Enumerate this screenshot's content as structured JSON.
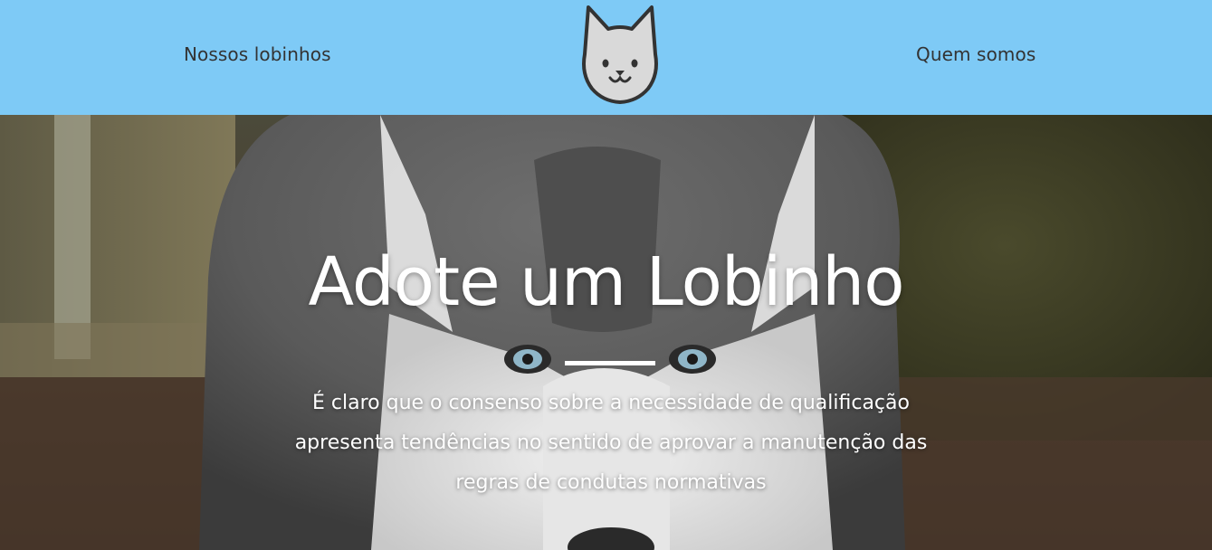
{
  "nav": {
    "left_link": "Nossos lobinhos",
    "right_link": "Quem somos",
    "logo_icon": "wolf-face-icon",
    "background_color": "#7ecaf6"
  },
  "hero": {
    "image_icon": "husky-photo",
    "title": "Adote um Lobinho",
    "description": "É claro que o consenso sobre a necessidade de qualificação apresenta tendências no sentido de aprovar a manutenção das regras de condutas normativas",
    "text_color": "#ffffff"
  }
}
